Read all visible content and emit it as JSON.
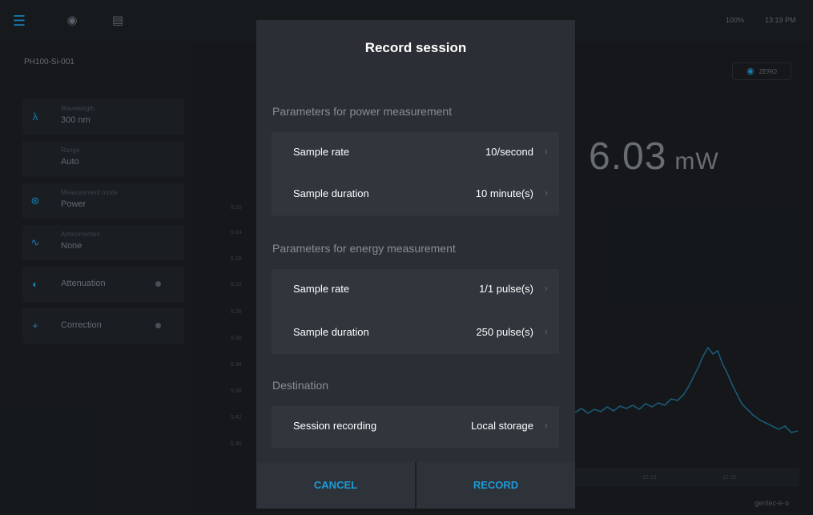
{
  "topbar": {
    "menu_icon": "menu-icon",
    "camera_icon": "camera-icon",
    "document_icon": "document-icon",
    "battery": "100%",
    "time": "13:19 PM"
  },
  "sidebar": {
    "device_name": "PH100-Si-001",
    "device_extra": "",
    "device_sub": "",
    "items": [
      {
        "label": "Wavelength",
        "value": "300 nm",
        "icon": "wavelength-icon"
      },
      {
        "label": "Range",
        "value": "Auto",
        "icon": "range-icon"
      },
      {
        "label": "Measurement mode",
        "value": "Power",
        "icon": "mode-icon"
      },
      {
        "label": "Anticorrection",
        "value": "None",
        "icon": "trigger-icon"
      },
      {
        "label": "",
        "value": "Attenuation",
        "icon": "attenuation-icon"
      },
      {
        "label": "",
        "value": "Correction",
        "icon": "correction-icon"
      }
    ]
  },
  "main": {
    "reading_value": "6.03",
    "reading_unit": "mW",
    "zoom_label": "ZERO",
    "y_ticks": [
      "5.10",
      "5.14",
      "5.18",
      "5.22",
      "5.26",
      "5.30",
      "5.34",
      "5.38",
      "5.42",
      "5.46"
    ],
    "x_ticks": [
      "12:15",
      "12:20"
    ],
    "brand": "gentec-e·o"
  },
  "modal": {
    "title": "Record session",
    "sections": [
      {
        "title": "Parameters for power measurement",
        "rows": [
          {
            "label": "Sample rate",
            "value": "10/second"
          },
          {
            "label": "Sample duration",
            "value": "10 minute(s)"
          }
        ]
      },
      {
        "title": "Parameters for energy measurement",
        "rows": [
          {
            "label": "Sample rate",
            "value": "1/1 pulse(s)"
          },
          {
            "label": "Sample duration",
            "value": "250 pulse(s)"
          }
        ]
      },
      {
        "title": "Destination",
        "rows": [
          {
            "label": "Session recording",
            "value": "Local storage"
          }
        ]
      }
    ],
    "cancel_label": "CANCEL",
    "record_label": "RECORD"
  },
  "colors": {
    "accent": "#1d9bd8",
    "modal_bg": "#2b2f35",
    "row_bg": "#31363d"
  }
}
